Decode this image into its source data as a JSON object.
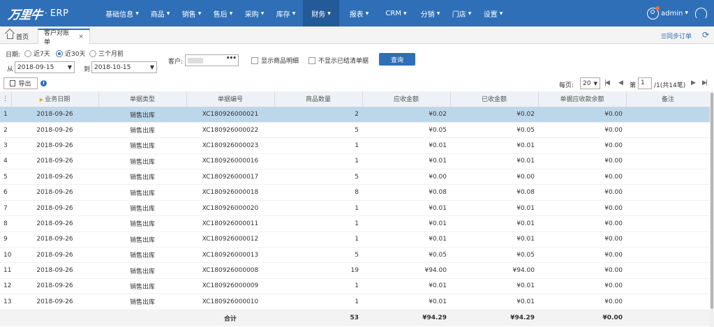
{
  "brand": {
    "logo": "万里牛",
    "dot": "·",
    "product": "ERP"
  },
  "nav": {
    "items": [
      {
        "label": "基础信息",
        "caret": true
      },
      {
        "label": "商品",
        "caret": true
      },
      {
        "label": "销售",
        "caret": true
      },
      {
        "label": "售后",
        "caret": true
      },
      {
        "label": "采购",
        "caret": true
      },
      {
        "label": "库存",
        "caret": true
      },
      {
        "label": "财务",
        "caret": true,
        "active": true
      },
      {
        "label": "报表",
        "caret": true
      },
      {
        "label": "CRM",
        "caret": true
      },
      {
        "label": "分销",
        "caret": true
      },
      {
        "label": "门店",
        "caret": true
      },
      {
        "label": "设置",
        "caret": true
      }
    ],
    "user": "admin"
  },
  "tabs": {
    "home": "首页",
    "active": "客户对账单",
    "close": "×",
    "sync": "☰同步订单"
  },
  "filters": {
    "date_label": "日期:",
    "range_7": "近7天",
    "range_30": "近30天",
    "range_3m": "三个月前",
    "from_label": "从",
    "from_value": "2018-09-15",
    "to_label": "到",
    "to_value": "2018-10-15",
    "customer_label": "客户:",
    "customer_picker": "•••",
    "show_detail": "显示商品明细",
    "hide_settled": "不显示已结清单据",
    "query": "查询"
  },
  "toolbar": {
    "export": "导出",
    "info": "i"
  },
  "pager": {
    "per_page_label": "每页:",
    "per_page": "20",
    "page_label": "第",
    "page": "1",
    "total": "/1(共14笔)"
  },
  "table": {
    "columns": [
      "业务日期",
      "单据类型",
      "单据编号",
      "商品数量",
      "应收金额",
      "已收金额",
      "单据应收款余额",
      "备注"
    ],
    "rows": [
      {
        "no": "1",
        "date": "2018-09-26",
        "type": "销售出库",
        "code": "XC180926000021",
        "qty": "2",
        "due": "¥0.02",
        "received": "¥0.02",
        "balance": "¥0.00",
        "note": ""
      },
      {
        "no": "2",
        "date": "2018-09-26",
        "type": "销售出库",
        "code": "XC180926000022",
        "qty": "5",
        "due": "¥0.05",
        "received": "¥0.05",
        "balance": "¥0.00",
        "note": ""
      },
      {
        "no": "3",
        "date": "2018-09-26",
        "type": "销售出库",
        "code": "XC180926000023",
        "qty": "1",
        "due": "¥0.01",
        "received": "¥0.01",
        "balance": "¥0.00",
        "note": ""
      },
      {
        "no": "4",
        "date": "2018-09-26",
        "type": "销售出库",
        "code": "XC180926000016",
        "qty": "1",
        "due": "¥0.01",
        "received": "¥0.01",
        "balance": "¥0.00",
        "note": ""
      },
      {
        "no": "5",
        "date": "2018-09-26",
        "type": "销售出库",
        "code": "XC180926000017",
        "qty": "5",
        "due": "¥0.00",
        "received": "¥0.00",
        "balance": "¥0.00",
        "note": ""
      },
      {
        "no": "6",
        "date": "2018-09-26",
        "type": "销售出库",
        "code": "XC180926000018",
        "qty": "8",
        "due": "¥0.08",
        "received": "¥0.08",
        "balance": "¥0.00",
        "note": ""
      },
      {
        "no": "7",
        "date": "2018-09-26",
        "type": "销售出库",
        "code": "XC180926000020",
        "qty": "1",
        "due": "¥0.01",
        "received": "¥0.01",
        "balance": "¥0.00",
        "note": ""
      },
      {
        "no": "8",
        "date": "2018-09-26",
        "type": "销售出库",
        "code": "XC180926000011",
        "qty": "1",
        "due": "¥0.01",
        "received": "¥0.01",
        "balance": "¥0.00",
        "note": ""
      },
      {
        "no": "9",
        "date": "2018-09-26",
        "type": "销售出库",
        "code": "XC180926000012",
        "qty": "1",
        "due": "¥0.01",
        "received": "¥0.01",
        "balance": "¥0.00",
        "note": ""
      },
      {
        "no": "10",
        "date": "2018-09-26",
        "type": "销售出库",
        "code": "XC180926000013",
        "qty": "5",
        "due": "¥0.05",
        "received": "¥0.05",
        "balance": "¥0.00",
        "note": ""
      },
      {
        "no": "11",
        "date": "2018-09-26",
        "type": "销售出库",
        "code": "XC180926000008",
        "qty": "19",
        "due": "¥94.00",
        "received": "¥94.00",
        "balance": "¥0.00",
        "note": ""
      },
      {
        "no": "12",
        "date": "2018-09-26",
        "type": "销售出库",
        "code": "XC180926000009",
        "qty": "1",
        "due": "¥0.01",
        "received": "¥0.01",
        "balance": "¥0.00",
        "note": ""
      },
      {
        "no": "13",
        "date": "2018-09-26",
        "type": "销售出库",
        "code": "XC180926000010",
        "qty": "1",
        "due": "¥0.01",
        "received": "¥0.01",
        "balance": "¥0.00",
        "note": ""
      }
    ],
    "total": {
      "label": "合计",
      "qty": "53",
      "due": "¥94.29",
      "received": "¥94.29",
      "balance": "¥0.00"
    }
  },
  "colors": {
    "nav_bg": "#2e6fb7",
    "nav_active": "#245a98",
    "selected_row": "#bdd7ea",
    "sort_arrow": "#f0a23a",
    "notify": "#f26b3a"
  }
}
